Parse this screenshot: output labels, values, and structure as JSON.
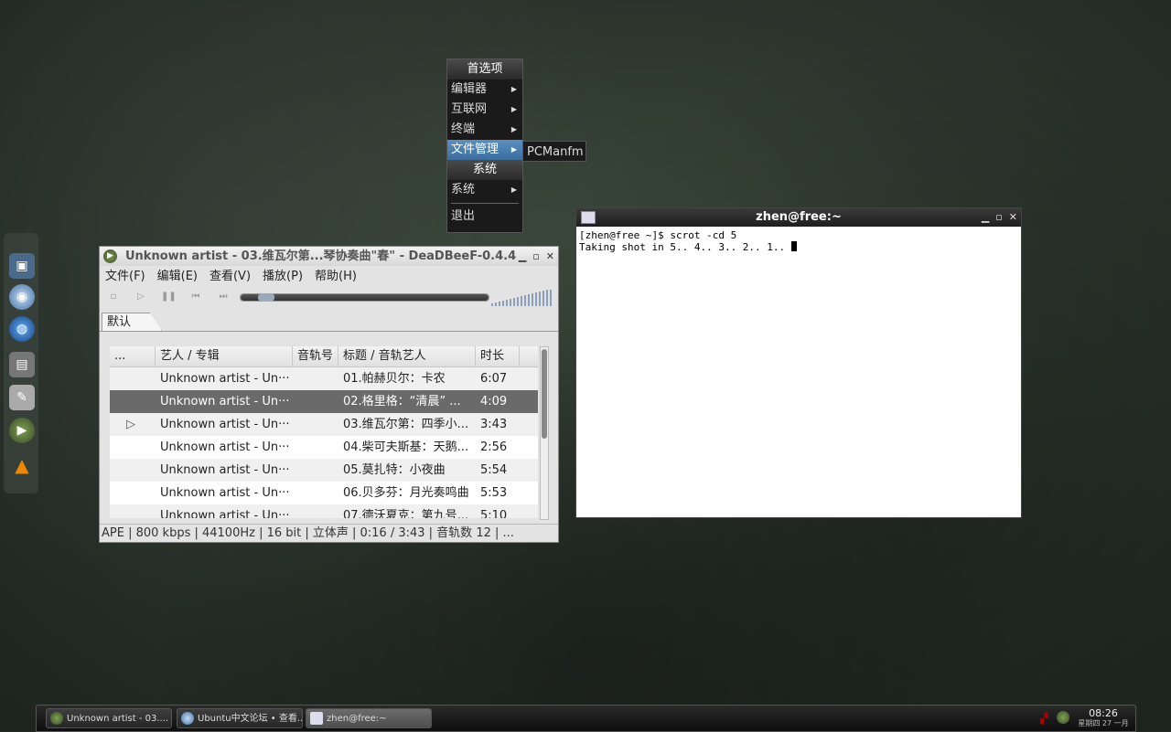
{
  "desktop": {
    "dock_icons": [
      "system-icon",
      "chromium-icon",
      "firefox-icon",
      "files-icon",
      "editor-icon",
      "deadbeef-icon",
      "vlc-icon"
    ]
  },
  "root_menu": {
    "title": "首选项",
    "items": [
      "编辑器",
      "互联网",
      "终端",
      "文件管理"
    ],
    "section_title": "系统",
    "system_item": "系统",
    "exit_item": "退出",
    "submenu_item": "PCManfm"
  },
  "terminal": {
    "title": "zhen@free:~",
    "line1": "[zhen@free ~]$ scrot -cd 5",
    "line2": "Taking shot in 5.. 4.. 3.. 2.. 1.. "
  },
  "player": {
    "title": "Unknown artist - 03.维瓦尔第...琴协奏曲\"春\" - DeaDBeeF-0.4.4",
    "menus": [
      "文件(F)",
      "编辑(E)",
      "查看(V)",
      "播放(P)",
      "帮助(H)"
    ],
    "progress": 0.07,
    "tab": "默认",
    "columns": [
      "...",
      "艺人 / 专辑",
      "音轨号",
      "标题 / 音轨艺人",
      "时长"
    ],
    "rows": [
      {
        "artist": "Unknown artist - Un···",
        "title": "01.帕赫贝尔：卡农",
        "duration": "6:07"
      },
      {
        "artist": "Unknown artist - Un···",
        "title": "02.格里格：“清晨” ...",
        "duration": "4:09"
      },
      {
        "artist": "Unknown artist - Un···",
        "title": "03.维瓦尔第：四季小...",
        "duration": "3:43"
      },
      {
        "artist": "Unknown artist - Un···",
        "title": "04.柴可夫斯基：天鹅...",
        "duration": "2:56"
      },
      {
        "artist": "Unknown artist - Un···",
        "title": "05.莫扎特：小夜曲",
        "duration": "5:54"
      },
      {
        "artist": "Unknown artist - Un···",
        "title": "06.贝多芬：月光奏鸣曲",
        "duration": "5:53"
      },
      {
        "artist": "Unknown artist - Un···",
        "title": "07.德沃夏克：第九号...",
        "duration": "5:10"
      }
    ],
    "status": "APE |  800 kbps | 44100Hz | 16 bit | 立体声  | 0:16 / 3:43  |  音轨数  12  |  ..."
  },
  "taskbar": {
    "tasks": [
      "Unknown artist - 03....",
      "Ubuntu中文论坛 • 查看...",
      "zhen@free:~"
    ],
    "time": "08:26",
    "date": "星期四 27 一月"
  }
}
